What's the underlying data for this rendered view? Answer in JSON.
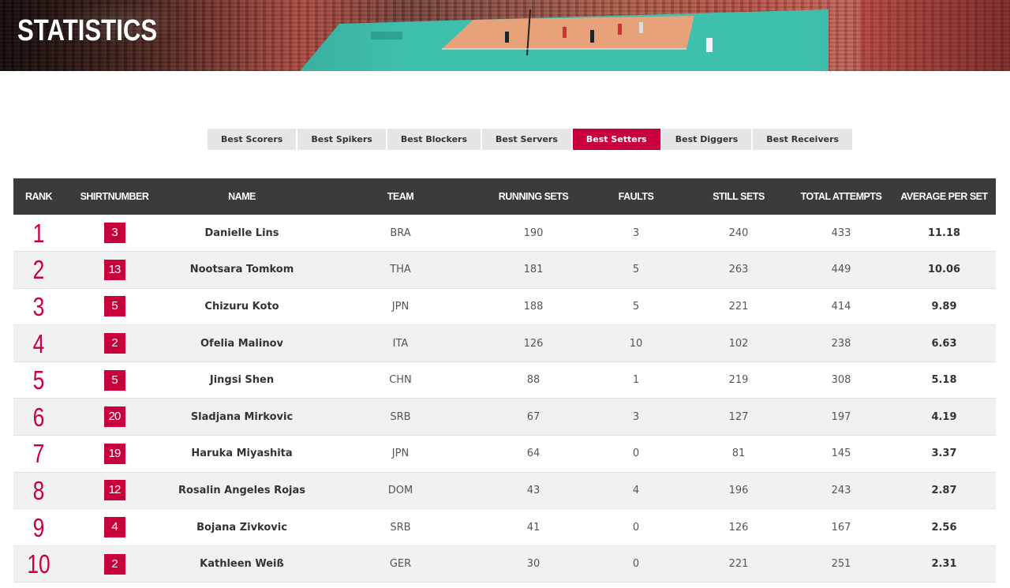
{
  "header": {
    "title": "STATISTICS"
  },
  "tabs": [
    {
      "label": "Best Scorers",
      "active": false
    },
    {
      "label": "Best Spikers",
      "active": false
    },
    {
      "label": "Best Blockers",
      "active": false
    },
    {
      "label": "Best Servers",
      "active": false
    },
    {
      "label": "Best Setters",
      "active": true
    },
    {
      "label": "Best Diggers",
      "active": false
    },
    {
      "label": "Best Receivers",
      "active": false
    }
  ],
  "table": {
    "columns": [
      "RANK",
      "SHIRTNUMBER",
      "NAME",
      "TEAM",
      "RUNNING SETS",
      "FAULTS",
      "STILL SETS",
      "TOTAL ATTEMPTS",
      "AVERAGE PER SET"
    ],
    "rows": [
      {
        "rank": "1",
        "shirt": "3",
        "name": "Danielle Lins",
        "team": "BRA",
        "running_sets": "190",
        "faults": "3",
        "still_sets": "240",
        "total_attempts": "433",
        "average": "11.18"
      },
      {
        "rank": "2",
        "shirt": "13",
        "name": "Nootsara Tomkom",
        "team": "THA",
        "running_sets": "181",
        "faults": "5",
        "still_sets": "263",
        "total_attempts": "449",
        "average": "10.06"
      },
      {
        "rank": "3",
        "shirt": "5",
        "name": "Chizuru Koto",
        "team": "JPN",
        "running_sets": "188",
        "faults": "5",
        "still_sets": "221",
        "total_attempts": "414",
        "average": "9.89"
      },
      {
        "rank": "4",
        "shirt": "2",
        "name": "Ofelia Malinov",
        "team": "ITA",
        "running_sets": "126",
        "faults": "10",
        "still_sets": "102",
        "total_attempts": "238",
        "average": "6.63"
      },
      {
        "rank": "5",
        "shirt": "5",
        "name": "Jingsi Shen",
        "team": "CHN",
        "running_sets": "88",
        "faults": "1",
        "still_sets": "219",
        "total_attempts": "308",
        "average": "5.18"
      },
      {
        "rank": "6",
        "shirt": "20",
        "name": "Sladjana Mirkovic",
        "team": "SRB",
        "running_sets": "67",
        "faults": "3",
        "still_sets": "127",
        "total_attempts": "197",
        "average": "4.19"
      },
      {
        "rank": "7",
        "shirt": "19",
        "name": "Haruka Miyashita",
        "team": "JPN",
        "running_sets": "64",
        "faults": "0",
        "still_sets": "81",
        "total_attempts": "145",
        "average": "3.37"
      },
      {
        "rank": "8",
        "shirt": "12",
        "name": "Rosalin Angeles Rojas",
        "team": "DOM",
        "running_sets": "43",
        "faults": "4",
        "still_sets": "196",
        "total_attempts": "243",
        "average": "2.87"
      },
      {
        "rank": "9",
        "shirt": "4",
        "name": "Bojana Zivkovic",
        "team": "SRB",
        "running_sets": "41",
        "faults": "0",
        "still_sets": "126",
        "total_attempts": "167",
        "average": "2.56"
      },
      {
        "rank": "10",
        "shirt": "2",
        "name": "Kathleen Weiß",
        "team": "GER",
        "running_sets": "30",
        "faults": "0",
        "still_sets": "221",
        "total_attempts": "251",
        "average": "2.31"
      }
    ]
  },
  "colors": {
    "accent": "#c8003c",
    "header_bg": "#3b3b3b",
    "tab_bg": "#e6e6e6",
    "row_alt": "#f2f1f1"
  }
}
